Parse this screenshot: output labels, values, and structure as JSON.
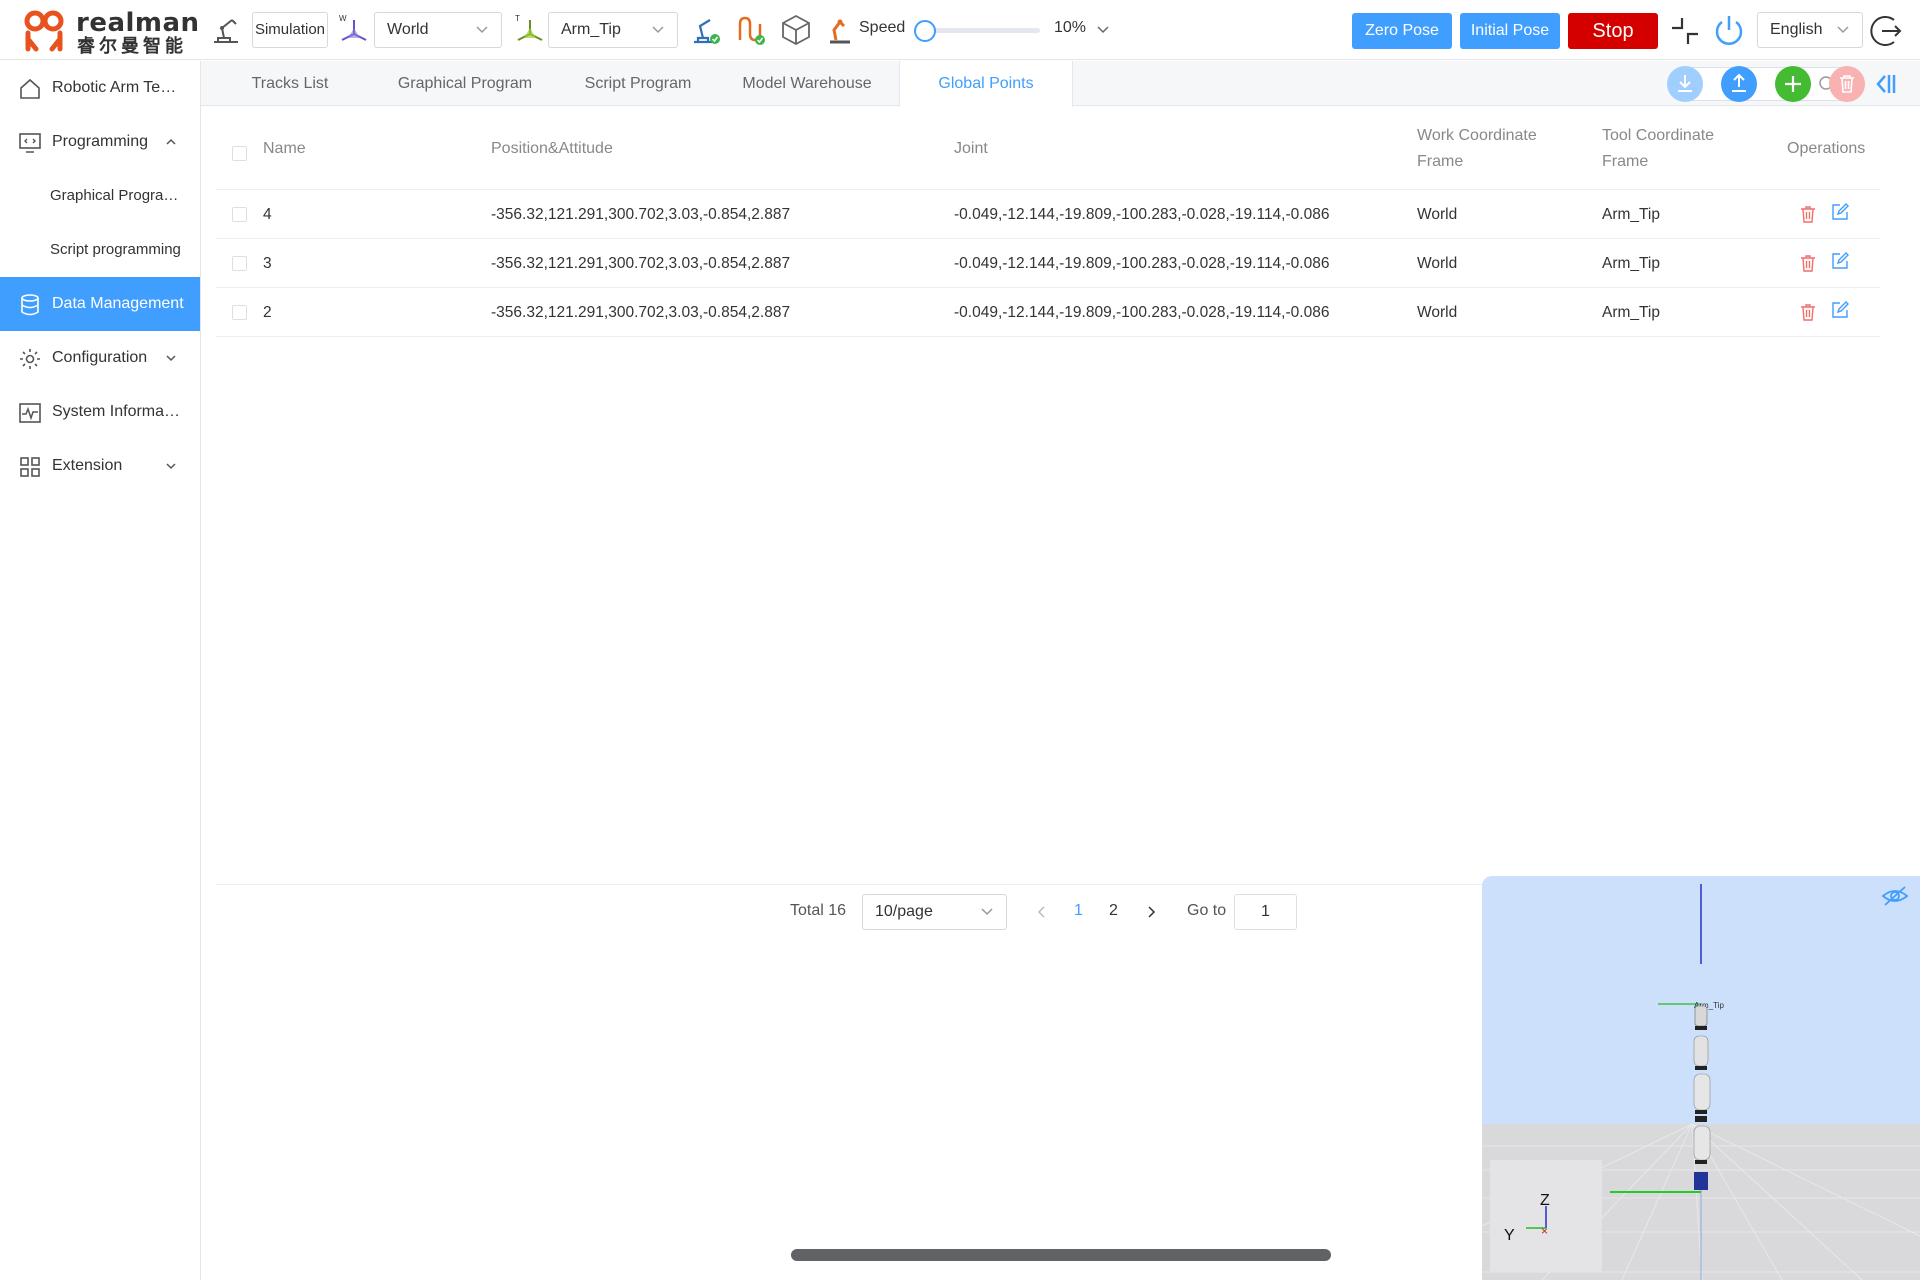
{
  "brand": {
    "name": "realman",
    "name_cn": "睿尔曼智能"
  },
  "toolbar": {
    "mode": "Simulation",
    "work_frame": "World",
    "tool_frame": "Arm_Tip",
    "speed_label": "Speed",
    "speed_value": "10%",
    "speed_fraction": 0.1,
    "zero_pose": "Zero Pose",
    "initial_pose": "Initial Pose",
    "stop": "Stop",
    "language": "English",
    "icons": [
      "arm-base-icon",
      "work-frame-icon",
      "tool-frame-icon",
      "arm-status-icon",
      "trajectory-icon",
      "model-cube-icon",
      "robot-speed-icon",
      "collapse-icon",
      "power-icon",
      "logout-icon"
    ]
  },
  "sidebar": {
    "items": [
      {
        "label": "Robotic Arm Teaching",
        "icon": "home-icon"
      },
      {
        "label": "Programming",
        "icon": "code-monitor-icon",
        "expanded": true
      },
      {
        "label": "Graphical Programming",
        "sub": true
      },
      {
        "label": "Script programming",
        "sub": true
      },
      {
        "label": "Data Management",
        "icon": "database-icon",
        "active": true
      },
      {
        "label": "Configuration",
        "icon": "settings-icon"
      },
      {
        "label": "System Information",
        "icon": "pulse-icon"
      },
      {
        "label": "Extension",
        "icon": "grid-icon"
      }
    ]
  },
  "tabs": [
    {
      "label": "Tracks List"
    },
    {
      "label": "Graphical Program"
    },
    {
      "label": "Script Program"
    },
    {
      "label": "Model Warehouse"
    },
    {
      "label": "Global Points",
      "active": true
    }
  ],
  "search": {
    "value": "",
    "placeholder": ""
  },
  "table": {
    "headers": {
      "name": "Name",
      "pose": "Position&Attitude",
      "joint": "Joint",
      "work_line1": "Work Coordinate",
      "work_line2": "Frame",
      "tool_line1": "Tool Coordinate",
      "tool_line2": "Frame",
      "ops": "Operations"
    },
    "rows": [
      {
        "name": "4",
        "pose": "-356.32,121.291,300.702,3.03,-0.854,2.887",
        "joint": "-0.049,-12.144,-19.809,-100.283,-0.028,-19.114,-0.086",
        "work": "World",
        "tool": "Arm_Tip"
      },
      {
        "name": "3",
        "pose": "-356.32,121.291,300.702,3.03,-0.854,2.887",
        "joint": "-0.049,-12.144,-19.809,-100.283,-0.028,-19.114,-0.086",
        "work": "World",
        "tool": "Arm_Tip"
      },
      {
        "name": "2",
        "pose": "-356.32,121.291,300.702,3.03,-0.854,2.887",
        "joint": "-0.049,-12.144,-19.809,-100.283,-0.028,-19.114,-0.086",
        "work": "World",
        "tool": "Arm_Tip"
      }
    ]
  },
  "pagination": {
    "total": "Total 16",
    "page_size": "10/page",
    "pages": [
      "1",
      "2"
    ],
    "current": "1",
    "goto_label": "Go to",
    "goto_value": "1"
  },
  "viewer": {
    "axis_z": "Z",
    "axis_y": "Y",
    "tool_label": "Arm_Tip",
    "colors": {
      "sky": "#cce0fb",
      "floor": "#d9d9dc",
      "accent": "#409eff"
    }
  }
}
